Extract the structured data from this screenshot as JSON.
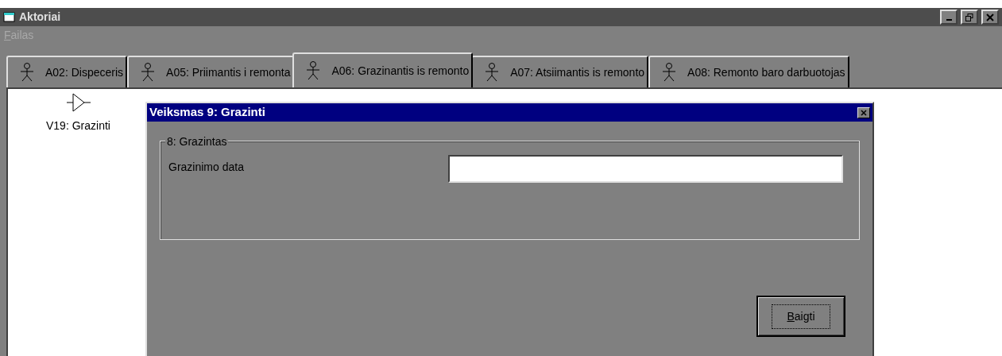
{
  "window": {
    "title": "Aktoriai"
  },
  "menu": [
    {
      "label": "Failas",
      "disabled": true
    }
  ],
  "tabs": [
    {
      "label": "A02: Dispeceris",
      "selected": false
    },
    {
      "label": "A05: Priimantis i remonta",
      "selected": false
    },
    {
      "label": "A06: Grazinantis is remonto",
      "selected": true
    },
    {
      "label": "A07: Atsiimantis is remonto",
      "selected": false
    },
    {
      "label": "A08: Remonto baro darbuotojas",
      "selected": false
    }
  ],
  "canvas": {
    "items": [
      {
        "label": "V19: Grazinti"
      }
    ]
  },
  "dialog": {
    "title": "Veiksmas 9: Grazinti",
    "group": {
      "title": "8: Grazintas",
      "fields": [
        {
          "label": "Grazinimo data"
        }
      ]
    },
    "buttons": [
      "Baigti"
    ]
  }
}
